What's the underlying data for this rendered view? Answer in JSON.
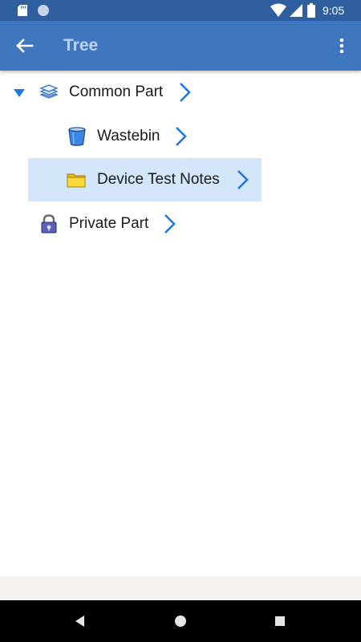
{
  "status_bar": {
    "time": "9:05",
    "icons": [
      "sd-card-icon",
      "notification-dot-icon",
      "wifi-icon",
      "cell-signal-icon",
      "battery-icon"
    ]
  },
  "app_bar": {
    "title": "Tree",
    "back_icon": "arrow-back-icon",
    "menu_icon": "more-vert-icon",
    "background": "#3f76c0",
    "title_color": "#b9d2f2"
  },
  "tree": {
    "nodes": [
      {
        "label": "Common Part",
        "icon": "layers-icon",
        "expanded": true,
        "level": 0
      },
      {
        "label": "Wastebin",
        "icon": "wastebin-icon",
        "level": 1
      },
      {
        "label": "Device Test Notes",
        "icon": "folder-icon",
        "level": 1,
        "selected": true
      },
      {
        "label": "Private Part",
        "icon": "lock-icon",
        "level": 0
      }
    ],
    "chevron_color": "#1e78e0",
    "selected_color": "#d4e6fa"
  },
  "nav_bar": {
    "buttons": [
      "back-triangle-icon",
      "home-circle-icon",
      "recents-square-icon"
    ]
  }
}
